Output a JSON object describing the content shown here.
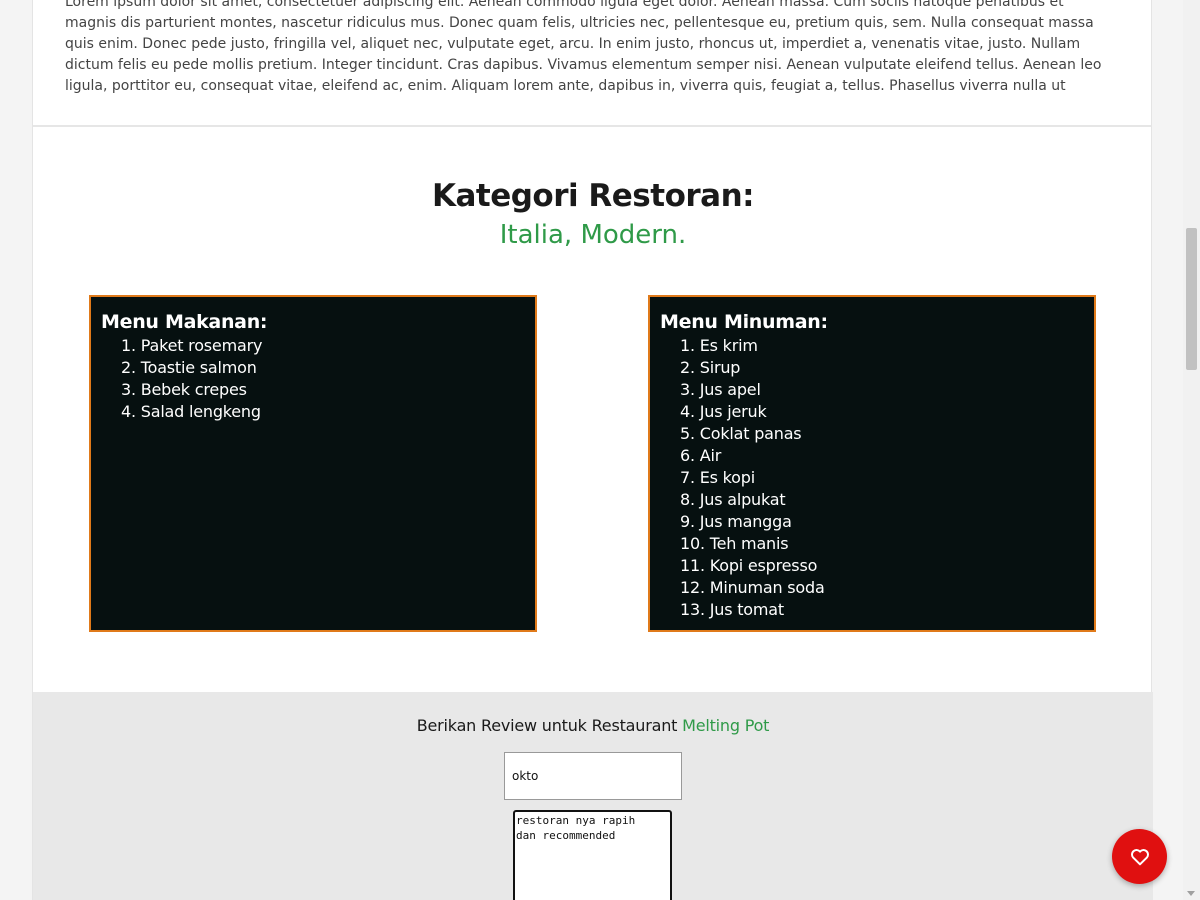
{
  "description": "Lorem ipsum dolor sit amet, consectetuer adipiscing elit. Aenean commodo ligula eget dolor. Aenean massa. Cum sociis natoque penatibus et magnis dis parturient montes, nascetur ridiculus mus. Donec quam felis, ultricies nec, pellentesque eu, pretium quis, sem. Nulla consequat massa quis enim. Donec pede justo, fringilla vel, aliquet nec, vulputate eget, arcu. In enim justo, rhoncus ut, imperdiet a, venenatis vitae, justo. Nullam dictum felis eu pede mollis pretium. Integer tincidunt. Cras dapibus. Vivamus elementum semper nisi. Aenean vulputate eleifend tellus. Aenean leo ligula, porttitor eu, consequat vitae, eleifend ac, enim. Aliquam lorem ante, dapibus in, viverra quis, feugiat a, tellus. Phasellus viverra nulla ut metus varius laoreet.",
  "category": {
    "title": "Kategori Restoran:",
    "values": "Italia, Modern."
  },
  "menu_food": {
    "title": "Menu Makanan:",
    "items": [
      "1. Paket rosemary",
      "2. Toastie salmon",
      "3. Bebek crepes",
      "4. Salad lengkeng"
    ]
  },
  "menu_drink": {
    "title": "Menu Minuman:",
    "items": [
      "1. Es krim",
      "2. Sirup",
      "3. Jus apel",
      "4. Jus jeruk",
      "5. Coklat panas",
      "6. Air",
      "7. Es kopi",
      "8. Jus alpukat",
      "9. Jus mangga",
      "10. Teh manis",
      "11. Kopi espresso",
      "12. Minuman soda",
      "13. Jus tomat"
    ]
  },
  "review": {
    "heading_prefix": "Berikan Review untuk Restaurant",
    "restaurant_name": "Melting Pot",
    "name_value": "okto",
    "review_value": "restoran nya rapih\ndan recommended"
  },
  "colors": {
    "accent_green": "#2f9a48",
    "menu_border": "#e07a1a",
    "menu_bg": "#061010",
    "fab_red": "#e01010"
  },
  "icons": {
    "fab": "heart-icon"
  }
}
